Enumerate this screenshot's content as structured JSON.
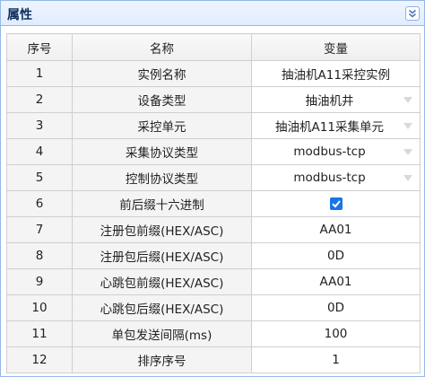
{
  "panel": {
    "title": "属性"
  },
  "icons": {
    "collapse": "double-chevron-down-icon",
    "dropdown": "triangle-down-icon",
    "checkbox": "checkmark-icon"
  },
  "colors": {
    "header_border": "#95b8e7",
    "title": "#0e2d5f",
    "checkbox": "#1a73e8"
  },
  "table": {
    "headers": [
      "序号",
      "名称",
      "变量"
    ],
    "rows": [
      {
        "index": "1",
        "name": "实例名称",
        "value": "抽油机A11采控实例",
        "type": "text"
      },
      {
        "index": "2",
        "name": "设备类型",
        "value": "抽油机井",
        "type": "combo"
      },
      {
        "index": "3",
        "name": "采控单元",
        "value": "抽油机A11采集单元",
        "type": "combo"
      },
      {
        "index": "4",
        "name": "采集协议类型",
        "value": "modbus-tcp",
        "type": "combo"
      },
      {
        "index": "5",
        "name": "控制协议类型",
        "value": "modbus-tcp",
        "type": "combo"
      },
      {
        "index": "6",
        "name": "前后缀十六进制",
        "value": "",
        "type": "checkbox",
        "checked": true
      },
      {
        "index": "7",
        "name": "注册包前缀(HEX/ASC)",
        "value": "AA01",
        "type": "text"
      },
      {
        "index": "8",
        "name": "注册包后缀(HEX/ASC)",
        "value": "0D",
        "type": "text"
      },
      {
        "index": "9",
        "name": "心跳包前缀(HEX/ASC)",
        "value": "AA01",
        "type": "text"
      },
      {
        "index": "10",
        "name": "心跳包后缀(HEX/ASC)",
        "value": "0D",
        "type": "text"
      },
      {
        "index": "11",
        "name": "单包发送间隔(ms)",
        "value": "100",
        "type": "text"
      },
      {
        "index": "12",
        "name": "排序序号",
        "value": "1",
        "type": "text"
      }
    ]
  }
}
